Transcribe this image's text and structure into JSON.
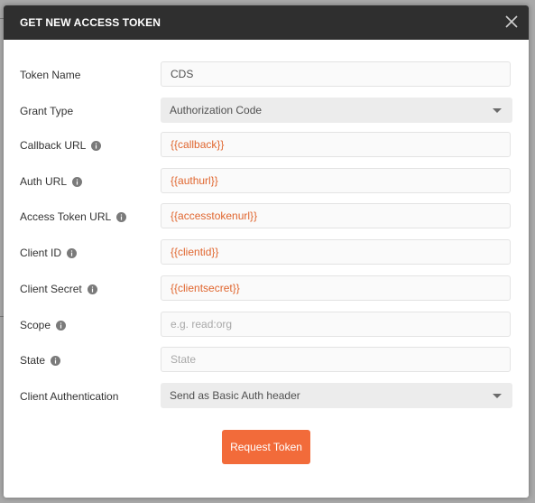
{
  "modal": {
    "title": "GET NEW ACCESS TOKEN",
    "close_icon": "close-icon"
  },
  "fields": {
    "token_name": {
      "label": "Token Name",
      "value": "CDS"
    },
    "grant_type": {
      "label": "Grant Type",
      "value": "Authorization Code"
    },
    "callback_url": {
      "label": "Callback URL",
      "value": "{{callback}}"
    },
    "auth_url": {
      "label": "Auth URL",
      "value": "{{authurl}}"
    },
    "access_token_url": {
      "label": "Access Token URL",
      "value": "{{accesstokenurl}}"
    },
    "client_id": {
      "label": "Client ID",
      "value": "{{clientid}}"
    },
    "client_secret": {
      "label": "Client Secret",
      "value": "{{clientsecret}}"
    },
    "scope": {
      "label": "Scope",
      "value": "",
      "placeholder": "e.g. read:org"
    },
    "state": {
      "label": "State",
      "value": "",
      "placeholder": "State"
    },
    "client_authentication": {
      "label": "Client Authentication",
      "value": "Send as Basic Auth header"
    }
  },
  "actions": {
    "request_token_label": "Request Token"
  },
  "colors": {
    "header_bg": "#2f2f2f",
    "accent": "#f26b3a",
    "variable_text": "#e0662f"
  }
}
